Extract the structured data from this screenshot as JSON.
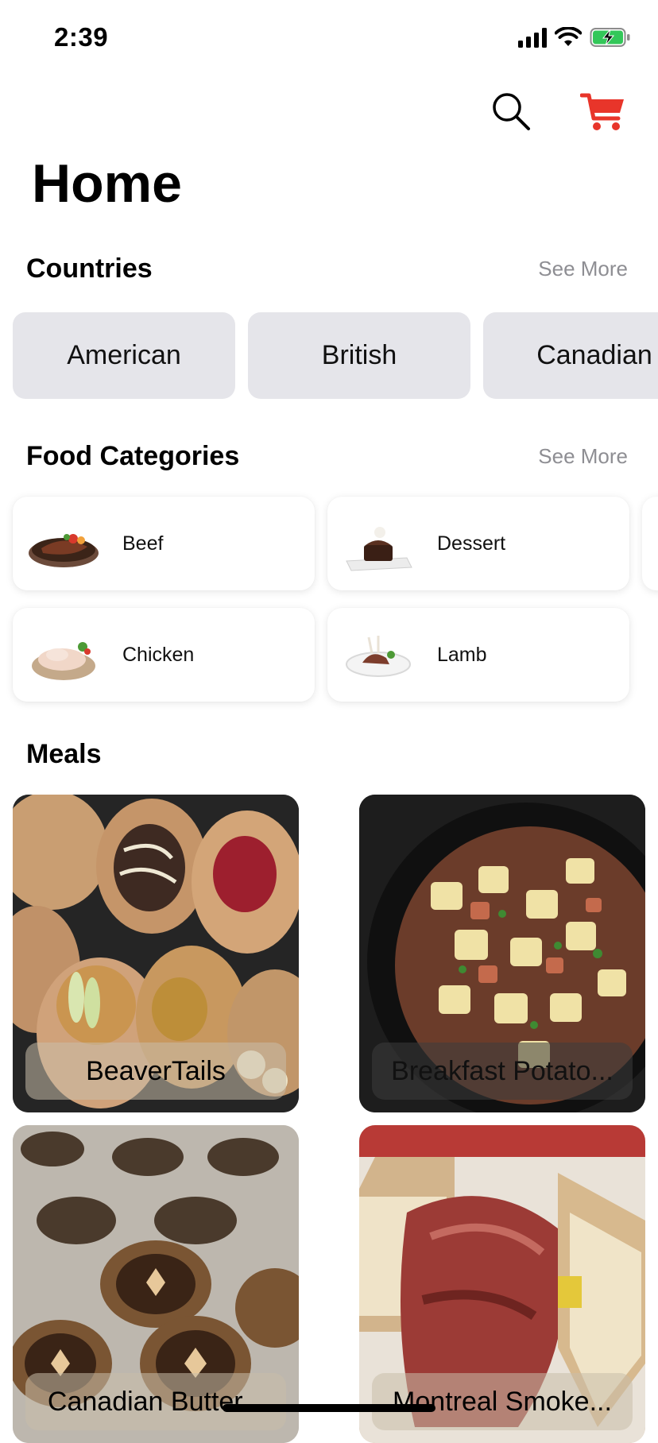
{
  "status_bar": {
    "time": "2:39",
    "icons": [
      "signal-icon",
      "wifi-icon",
      "battery-charging-icon"
    ]
  },
  "header": {
    "search_icon": "search-icon",
    "cart_icon": "cart-icon",
    "title": "Home"
  },
  "colors": {
    "accent": "#e8352a",
    "chip_bg": "#e5e5ea",
    "muted": "#8e8e93"
  },
  "countries": {
    "title": "Countries",
    "see_more": "See More",
    "items": [
      {
        "label": "American"
      },
      {
        "label": "British"
      },
      {
        "label": "Canadian"
      }
    ]
  },
  "food_categories": {
    "title": "Food Categories",
    "see_more": "See More",
    "items": [
      {
        "label": "Beef",
        "icon": "beef-dish-icon"
      },
      {
        "label": "Dessert",
        "icon": "dessert-dish-icon"
      },
      {
        "label": "Chicken",
        "icon": "chicken-dish-icon"
      },
      {
        "label": "Lamb",
        "icon": "lamb-dish-icon"
      }
    ]
  },
  "meals": {
    "title": "Meals",
    "items": [
      {
        "label": "BeaverTails"
      },
      {
        "label": "Breakfast Potato..."
      },
      {
        "label": "Canadian Butter..."
      },
      {
        "label": "Montreal Smoke..."
      }
    ]
  }
}
